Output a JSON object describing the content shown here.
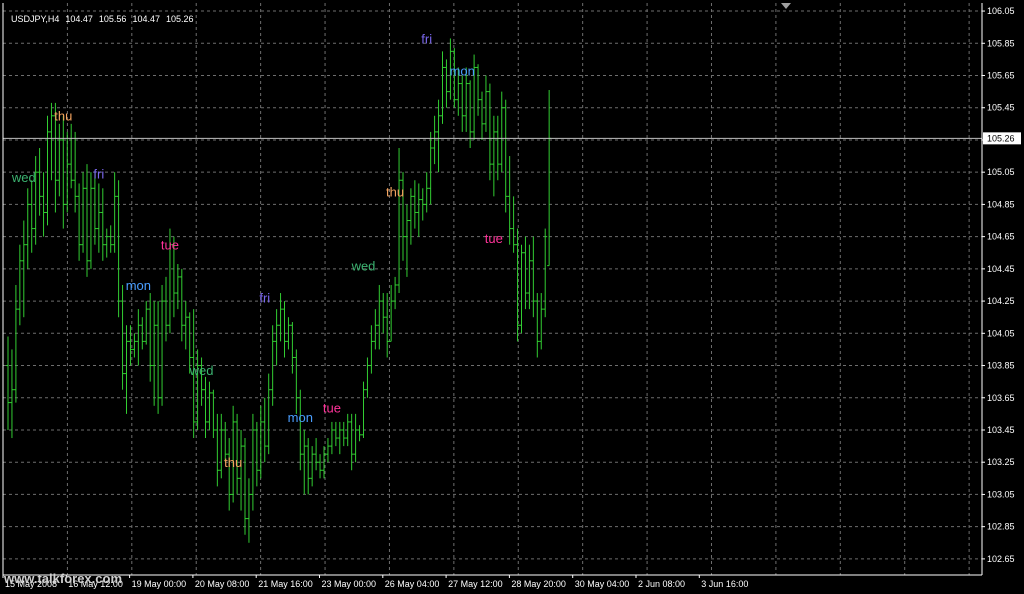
{
  "header": {
    "symbol": "USDJPY,H4",
    "open": "104.47",
    "high": "105.56",
    "low": "104.47",
    "close": "105.26"
  },
  "current_price_label": "105.26",
  "watermark": "www.talkforex.com",
  "colors": {
    "background": "#000000",
    "grid": "#6e6e6e",
    "bar": "#32cd32",
    "axis": "#ffffff",
    "price_line": "#c0c0c0"
  },
  "chart_data": {
    "type": "ohlc",
    "symbol": "USDJPY",
    "timeframe": "H4",
    "ylim": [
      102.55,
      106.1
    ],
    "price_ticks": [
      "106.05",
      "105.85",
      "105.65",
      "105.45",
      "105.25",
      "105.05",
      "104.85",
      "104.65",
      "104.45",
      "104.25",
      "104.05",
      "103.85",
      "103.65",
      "103.45",
      "103.25",
      "103.05",
      "102.85",
      "102.65"
    ],
    "time_labels": [
      "15 May 2008",
      "16 May 12:00",
      "19 May 00:00",
      "20 May 08:00",
      "21 May 16:00",
      "23 May 00:00",
      "26 May 04:00",
      "27 May 12:00",
      "28 May 20:00",
      "30 May 04:00",
      "2 Jun 08:00",
      "3 Jun 16:00"
    ],
    "current_price": 105.26,
    "day_labels": [
      {
        "text": "wed",
        "bar": 4,
        "price": 104.99,
        "color": "#3cb371"
      },
      {
        "text": "thu",
        "bar": 14,
        "price": 105.37,
        "color": "#f4a460"
      },
      {
        "text": "fri",
        "bar": 23,
        "price": 105.01,
        "color": "#7b68ee"
      },
      {
        "text": "mon",
        "bar": 33,
        "price": 104.32,
        "color": "#4a9eff"
      },
      {
        "text": "tue",
        "bar": 41,
        "price": 104.57,
        "color": "#ff3399"
      },
      {
        "text": "wed",
        "bar": 49,
        "price": 103.79,
        "color": "#3cb371"
      },
      {
        "text": "thu",
        "bar": 57,
        "price": 103.22,
        "color": "#f4a460"
      },
      {
        "text": "fri",
        "bar": 65,
        "price": 104.24,
        "color": "#7b68ee"
      },
      {
        "text": "mon",
        "bar": 74,
        "price": 103.5,
        "color": "#4a9eff"
      },
      {
        "text": "tue",
        "bar": 82,
        "price": 103.56,
        "color": "#ff3399"
      },
      {
        "text": "wed",
        "bar": 90,
        "price": 104.44,
        "color": "#3cb371"
      },
      {
        "text": "thu",
        "bar": 98,
        "price": 104.9,
        "color": "#f4a460"
      },
      {
        "text": "fri",
        "bar": 106,
        "price": 105.85,
        "color": "#7b68ee"
      },
      {
        "text": "mon",
        "bar": 115,
        "price": 105.65,
        "color": "#4a9eff"
      },
      {
        "text": "tue",
        "bar": 123,
        "price": 104.61,
        "color": "#ff3399"
      }
    ],
    "bars": [
      {
        "o": 103.85,
        "h": 104.03,
        "l": 103.45,
        "c": 103.62
      },
      {
        "o": 103.62,
        "h": 103.95,
        "l": 103.4,
        "c": 103.7
      },
      {
        "o": 103.7,
        "h": 104.35,
        "l": 103.62,
        "c": 104.2
      },
      {
        "o": 104.2,
        "h": 104.6,
        "l": 104.1,
        "c": 104.5
      },
      {
        "o": 104.5,
        "h": 104.75,
        "l": 104.15,
        "c": 104.6
      },
      {
        "o": 104.6,
        "h": 104.95,
        "l": 104.45,
        "c": 104.85
      },
      {
        "o": 104.85,
        "h": 105.0,
        "l": 104.55,
        "c": 104.7
      },
      {
        "o": 104.7,
        "h": 105.15,
        "l": 104.6,
        "c": 105.05
      },
      {
        "o": 105.05,
        "h": 105.2,
        "l": 104.78,
        "c": 104.9
      },
      {
        "o": 104.9,
        "h": 105.05,
        "l": 104.65,
        "c": 104.8
      },
      {
        "o": 104.8,
        "h": 105.4,
        "l": 104.72,
        "c": 105.3
      },
      {
        "o": 105.3,
        "h": 105.48,
        "l": 105.0,
        "c": 105.4
      },
      {
        "o": 105.4,
        "h": 105.48,
        "l": 104.8,
        "c": 105.0
      },
      {
        "o": 105.0,
        "h": 105.35,
        "l": 104.9,
        "c": 105.25
      },
      {
        "o": 105.25,
        "h": 105.4,
        "l": 104.7,
        "c": 104.85
      },
      {
        "o": 104.85,
        "h": 105.3,
        "l": 104.8,
        "c": 105.1
      },
      {
        "o": 105.1,
        "h": 105.35,
        "l": 104.95,
        "c": 105.0
      },
      {
        "o": 105.0,
        "h": 105.3,
        "l": 104.8,
        "c": 104.9
      },
      {
        "o": 104.9,
        "h": 104.98,
        "l": 104.5,
        "c": 104.6
      },
      {
        "o": 104.6,
        "h": 105.05,
        "l": 104.55,
        "c": 104.95
      },
      {
        "o": 104.95,
        "h": 105.1,
        "l": 104.4,
        "c": 104.5
      },
      {
        "o": 104.5,
        "h": 105.05,
        "l": 104.45,
        "c": 104.95
      },
      {
        "o": 104.95,
        "h": 105.05,
        "l": 104.6,
        "c": 104.7
      },
      {
        "o": 104.7,
        "h": 104.98,
        "l": 104.55,
        "c": 104.8
      },
      {
        "o": 104.8,
        "h": 104.95,
        "l": 104.5,
        "c": 104.6
      },
      {
        "o": 104.6,
        "h": 104.7,
        "l": 104.52,
        "c": 104.65
      },
      {
        "o": 104.65,
        "h": 104.72,
        "l": 104.55,
        "c": 104.6
      },
      {
        "o": 104.6,
        "h": 105.05,
        "l": 104.55,
        "c": 104.9
      },
      {
        "o": 104.9,
        "h": 105.0,
        "l": 104.15,
        "c": 104.25
      },
      {
        "o": 104.25,
        "h": 104.35,
        "l": 103.7,
        "c": 103.8
      },
      {
        "o": 103.8,
        "h": 104.1,
        "l": 103.55,
        "c": 104.0
      },
      {
        "o": 104.0,
        "h": 104.1,
        "l": 103.85,
        "c": 103.95
      },
      {
        "o": 103.95,
        "h": 104.05,
        "l": 103.9,
        "c": 104.0
      },
      {
        "o": 104.0,
        "h": 104.2,
        "l": 103.85,
        "c": 104.1
      },
      {
        "o": 104.1,
        "h": 104.15,
        "l": 103.95,
        "c": 104.0
      },
      {
        "o": 104.0,
        "h": 104.25,
        "l": 103.98,
        "c": 104.2
      },
      {
        "o": 104.2,
        "h": 104.3,
        "l": 103.75,
        "c": 103.85
      },
      {
        "o": 103.85,
        "h": 104.25,
        "l": 103.6,
        "c": 104.1
      },
      {
        "o": 104.1,
        "h": 104.25,
        "l": 103.55,
        "c": 103.65
      },
      {
        "o": 103.65,
        "h": 104.35,
        "l": 103.6,
        "c": 104.25
      },
      {
        "o": 104.25,
        "h": 104.4,
        "l": 104.0,
        "c": 104.1
      },
      {
        "o": 104.1,
        "h": 104.7,
        "l": 104.05,
        "c": 104.6
      },
      {
        "o": 104.6,
        "h": 104.65,
        "l": 104.15,
        "c": 104.3
      },
      {
        "o": 104.3,
        "h": 104.48,
        "l": 104.2,
        "c": 104.4
      },
      {
        "o": 104.4,
        "h": 104.45,
        "l": 104.0,
        "c": 104.1
      },
      {
        "o": 104.1,
        "h": 104.25,
        "l": 103.95,
        "c": 104.15
      },
      {
        "o": 104.15,
        "h": 104.18,
        "l": 103.8,
        "c": 103.9
      },
      {
        "o": 103.9,
        "h": 104.2,
        "l": 103.4,
        "c": 103.5
      },
      {
        "o": 103.5,
        "h": 103.95,
        "l": 103.45,
        "c": 103.85
      },
      {
        "o": 103.85,
        "h": 103.9,
        "l": 103.6,
        "c": 103.7
      },
      {
        "o": 103.7,
        "h": 103.78,
        "l": 103.4,
        "c": 103.5
      },
      {
        "o": 103.5,
        "h": 103.75,
        "l": 103.45,
        "c": 103.68
      },
      {
        "o": 103.68,
        "h": 103.7,
        "l": 103.4,
        "c": 103.45
      },
      {
        "o": 103.45,
        "h": 103.55,
        "l": 103.1,
        "c": 103.2
      },
      {
        "o": 103.2,
        "h": 103.55,
        "l": 103.15,
        "c": 103.45
      },
      {
        "o": 103.45,
        "h": 103.5,
        "l": 103.25,
        "c": 103.3
      },
      {
        "o": 103.3,
        "h": 103.4,
        "l": 102.95,
        "c": 103.05
      },
      {
        "o": 103.05,
        "h": 103.6,
        "l": 103.0,
        "c": 103.5
      },
      {
        "o": 103.5,
        "h": 103.55,
        "l": 103.05,
        "c": 103.15
      },
      {
        "o": 103.15,
        "h": 103.45,
        "l": 102.95,
        "c": 103.35
      },
      {
        "o": 103.35,
        "h": 103.4,
        "l": 102.8,
        "c": 102.9
      },
      {
        "o": 102.9,
        "h": 103.15,
        "l": 102.75,
        "c": 103.05
      },
      {
        "o": 103.05,
        "h": 103.55,
        "l": 102.95,
        "c": 103.45
      },
      {
        "o": 103.45,
        "h": 103.5,
        "l": 103.1,
        "c": 103.2
      },
      {
        "o": 103.2,
        "h": 103.6,
        "l": 103.15,
        "c": 103.5
      },
      {
        "o": 103.5,
        "h": 103.65,
        "l": 103.25,
        "c": 103.35
      },
      {
        "o": 103.35,
        "h": 103.8,
        "l": 103.3,
        "c": 103.7
      },
      {
        "o": 103.7,
        "h": 104.1,
        "l": 103.6,
        "c": 104.0
      },
      {
        "o": 104.0,
        "h": 104.2,
        "l": 103.85,
        "c": 104.1
      },
      {
        "o": 104.1,
        "h": 104.3,
        "l": 104.0,
        "c": 104.2
      },
      {
        "o": 104.2,
        "h": 104.25,
        "l": 103.9,
        "c": 104.0
      },
      {
        "o": 104.0,
        "h": 104.15,
        "l": 103.95,
        "c": 104.1
      },
      {
        "o": 104.1,
        "h": 104.12,
        "l": 103.8,
        "c": 103.9
      },
      {
        "o": 103.9,
        "h": 103.95,
        "l": 103.55,
        "c": 103.65
      },
      {
        "o": 103.65,
        "h": 103.7,
        "l": 103.2,
        "c": 103.3
      },
      {
        "o": 103.3,
        "h": 103.45,
        "l": 103.05,
        "c": 103.35
      },
      {
        "o": 103.35,
        "h": 103.4,
        "l": 103.05,
        "c": 103.15
      },
      {
        "o": 103.15,
        "h": 103.35,
        "l": 103.1,
        "c": 103.3
      },
      {
        "o": 103.3,
        "h": 103.4,
        "l": 103.2,
        "c": 103.25
      },
      {
        "o": 103.25,
        "h": 103.3,
        "l": 103.15,
        "c": 103.2
      },
      {
        "o": 103.2,
        "h": 103.35,
        "l": 103.15,
        "c": 103.3
      },
      {
        "o": 103.3,
        "h": 103.4,
        "l": 103.25,
        "c": 103.35
      },
      {
        "o": 103.35,
        "h": 103.5,
        "l": 103.3,
        "c": 103.45
      },
      {
        "o": 103.45,
        "h": 103.5,
        "l": 103.35,
        "c": 103.4
      },
      {
        "o": 103.4,
        "h": 103.5,
        "l": 103.3,
        "c": 103.45
      },
      {
        "o": 103.45,
        "h": 103.5,
        "l": 103.35,
        "c": 103.4
      },
      {
        "o": 103.4,
        "h": 103.55,
        "l": 103.35,
        "c": 103.5
      },
      {
        "o": 103.5,
        "h": 103.55,
        "l": 103.2,
        "c": 103.3
      },
      {
        "o": 103.3,
        "h": 103.55,
        "l": 103.25,
        "c": 103.45
      },
      {
        "o": 103.45,
        "h": 103.48,
        "l": 103.38,
        "c": 103.42
      },
      {
        "o": 103.42,
        "h": 103.75,
        "l": 103.4,
        "c": 103.7
      },
      {
        "o": 103.7,
        "h": 103.9,
        "l": 103.65,
        "c": 103.85
      },
      {
        "o": 103.85,
        "h": 104.1,
        "l": 103.8,
        "c": 104.0
      },
      {
        "o": 104.0,
        "h": 104.2,
        "l": 103.95,
        "c": 104.1
      },
      {
        "o": 104.1,
        "h": 104.35,
        "l": 103.95,
        "c": 104.25
      },
      {
        "o": 104.25,
        "h": 104.3,
        "l": 104.05,
        "c": 104.15
      },
      {
        "o": 104.15,
        "h": 104.3,
        "l": 103.9,
        "c": 104.0
      },
      {
        "o": 104.0,
        "h": 104.35,
        "l": 104.0,
        "c": 104.25
      },
      {
        "o": 104.25,
        "h": 104.4,
        "l": 104.2,
        "c": 104.35
      },
      {
        "o": 104.35,
        "h": 105.2,
        "l": 104.3,
        "c": 105.0
      },
      {
        "o": 105.0,
        "h": 105.05,
        "l": 104.5,
        "c": 104.65
      },
      {
        "o": 104.65,
        "h": 104.85,
        "l": 104.4,
        "c": 104.75
      },
      {
        "o": 104.75,
        "h": 104.95,
        "l": 104.6,
        "c": 104.9
      },
      {
        "o": 104.9,
        "h": 105.0,
        "l": 104.7,
        "c": 104.8
      },
      {
        "o": 104.8,
        "h": 104.98,
        "l": 104.65,
        "c": 104.88
      },
      {
        "o": 104.88,
        "h": 104.95,
        "l": 104.75,
        "c": 104.85
      },
      {
        "o": 104.85,
        "h": 105.05,
        "l": 104.8,
        "c": 104.95
      },
      {
        "o": 104.95,
        "h": 105.3,
        "l": 104.85,
        "c": 105.2
      },
      {
        "o": 105.2,
        "h": 105.4,
        "l": 105.1,
        "c": 105.3
      },
      {
        "o": 105.3,
        "h": 105.5,
        "l": 105.05,
        "c": 105.4
      },
      {
        "o": 105.4,
        "h": 105.8,
        "l": 105.35,
        "c": 105.7
      },
      {
        "o": 105.7,
        "h": 105.75,
        "l": 105.45,
        "c": 105.55
      },
      {
        "o": 105.55,
        "h": 105.88,
        "l": 105.5,
        "c": 105.8
      },
      {
        "o": 105.8,
        "h": 105.82,
        "l": 105.45,
        "c": 105.5
      },
      {
        "o": 105.5,
        "h": 105.7,
        "l": 105.4,
        "c": 105.6
      },
      {
        "o": 105.6,
        "h": 105.65,
        "l": 105.3,
        "c": 105.4
      },
      {
        "o": 105.4,
        "h": 105.7,
        "l": 105.3,
        "c": 105.6
      },
      {
        "o": 105.6,
        "h": 105.62,
        "l": 105.2,
        "c": 105.3
      },
      {
        "o": 105.3,
        "h": 105.78,
        "l": 105.25,
        "c": 105.7
      },
      {
        "o": 105.7,
        "h": 105.72,
        "l": 105.4,
        "c": 105.5
      },
      {
        "o": 105.5,
        "h": 105.55,
        "l": 105.25,
        "c": 105.35
      },
      {
        "o": 105.35,
        "h": 105.65,
        "l": 105.3,
        "c": 105.55
      },
      {
        "o": 105.55,
        "h": 105.6,
        "l": 105.0,
        "c": 105.1
      },
      {
        "o": 105.1,
        "h": 105.4,
        "l": 104.9,
        "c": 105.3
      },
      {
        "o": 105.3,
        "h": 105.4,
        "l": 105.0,
        "c": 105.1
      },
      {
        "o": 105.1,
        "h": 105.55,
        "l": 105.05,
        "c": 105.45
      },
      {
        "o": 105.45,
        "h": 105.5,
        "l": 104.8,
        "c": 104.9
      },
      {
        "o": 104.9,
        "h": 105.15,
        "l": 104.6,
        "c": 104.7
      },
      {
        "o": 104.7,
        "h": 104.9,
        "l": 104.55,
        "c": 104.6
      },
      {
        "o": 104.6,
        "h": 104.7,
        "l": 104.0,
        "c": 104.1
      },
      {
        "o": 104.1,
        "h": 104.6,
        "l": 104.05,
        "c": 104.55
      },
      {
        "o": 104.55,
        "h": 104.65,
        "l": 104.2,
        "c": 104.3
      },
      {
        "o": 104.3,
        "h": 104.6,
        "l": 104.2,
        "c": 104.5
      },
      {
        "o": 104.5,
        "h": 104.65,
        "l": 104.15,
        "c": 104.25
      },
      {
        "o": 104.25,
        "h": 104.3,
        "l": 103.9,
        "c": 104.0
      },
      {
        "o": 104.0,
        "h": 104.3,
        "l": 103.95,
        "c": 104.2
      },
      {
        "o": 104.2,
        "h": 104.7,
        "l": 104.15,
        "c": 104.65
      },
      {
        "o": 104.47,
        "h": 105.56,
        "l": 104.47,
        "c": 105.26
      }
    ]
  }
}
